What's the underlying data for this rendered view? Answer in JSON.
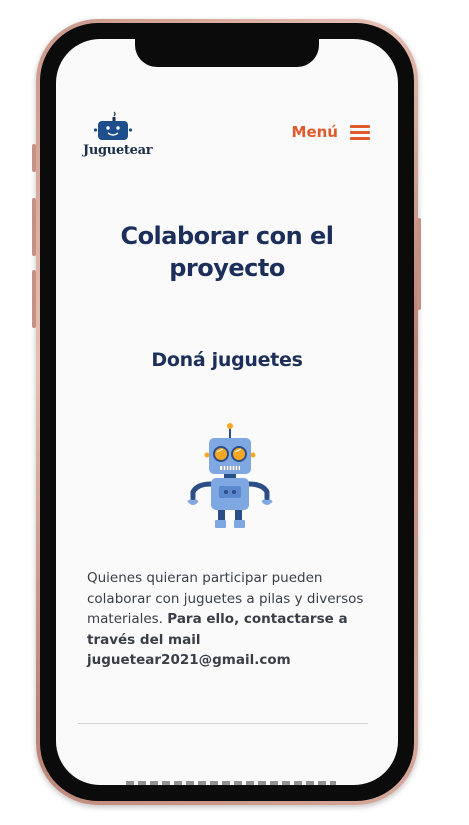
{
  "header": {
    "brand": "Juguetear",
    "menu_label": "Menú"
  },
  "main": {
    "title": "Colaborar con el proyecto",
    "section_title": "Doná juguetes",
    "paragraph_plain": "Quienes quieran participar pueden colaborar con juguetes a pilas y diversos materiales. ",
    "paragraph_bold": "Para ello, contactarse a través del mail juguetear2021@gmail.com"
  },
  "colors": {
    "accent": "#e05a2b",
    "navy": "#1c2e5a",
    "robot_blue": "#7fa8e3",
    "robot_dark": "#2b4e86",
    "robot_eye": "#f5a623"
  },
  "icons": [
    "robot-logo-icon",
    "hamburger-menu-icon",
    "robot-illustration"
  ]
}
